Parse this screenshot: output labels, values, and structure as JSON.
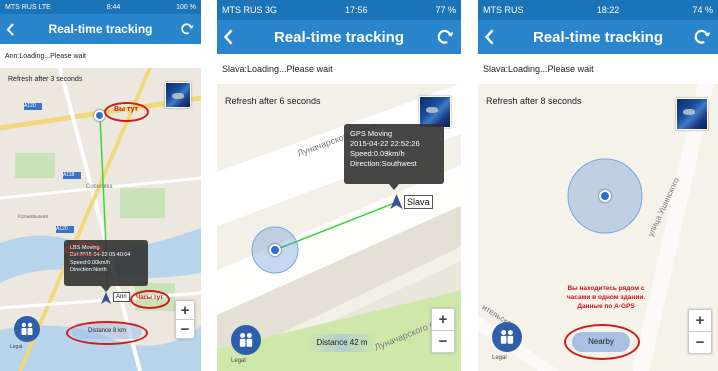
{
  "colors": {
    "navbar": "#2a86cc",
    "statusbar": "#1b74b8",
    "annotation": "#d11b1b",
    "route": "#3ed43a",
    "accuracy": "#5f92d6"
  },
  "panels": [
    {
      "status": {
        "carrier": "MTS RUS  LTE",
        "time": "8:44",
        "battery": "100 %"
      },
      "title": "Real-time tracking",
      "info": "Ann:Loading...Please wait",
      "refresh": "Refresh after 3 seconds",
      "popup": {
        "lines": [
          "LBS Moving",
          "Bei:2015-04-22 05:40:04",
          "Speed:0.00km/h",
          "Direction:North"
        ]
      },
      "device_label": "Ann",
      "distance": "Distance 8 km",
      "annotations": {
        "you_here": "Вы тут",
        "watch_here": "Часы тут"
      },
      "map_labels": [
        "Сосновка",
        "Кальмаьзкая",
        "A120",
        "A120",
        "A118"
      ],
      "legal": "Legal"
    },
    {
      "status": {
        "carrier": "MTS RUS  3G",
        "time": "17:56",
        "battery": "77 %"
      },
      "title": "Real-time tracking",
      "info": "Slava:Loading...Please wait",
      "refresh": "Refresh after 6 seconds",
      "popup": {
        "lines": [
          "GPS Moving",
          "2015-04-22 22:52:26",
          "Speed:0.09km/h",
          "Direction:Southwest"
        ]
      },
      "device_label": "Slava",
      "distance": "Distance 42 m",
      "streets": [
        "Луначарского просп.",
        "Луначарского прос"
      ],
      "legal": "Legal"
    },
    {
      "status": {
        "carrier": "MTS RUS",
        "time": "18:22",
        "battery": "74 %"
      },
      "title": "Real-time tracking",
      "info": "Slava:Loading...Please wait",
      "refresh": "Refresh after 8 seconds",
      "nearby": "Nearby",
      "annotation": "Вы находитесь рядом с часами в одном здании. Данные по A-GPS",
      "streets": [
        "улица Ушинского",
        "ительская"
      ],
      "legal": "Legal"
    }
  ]
}
